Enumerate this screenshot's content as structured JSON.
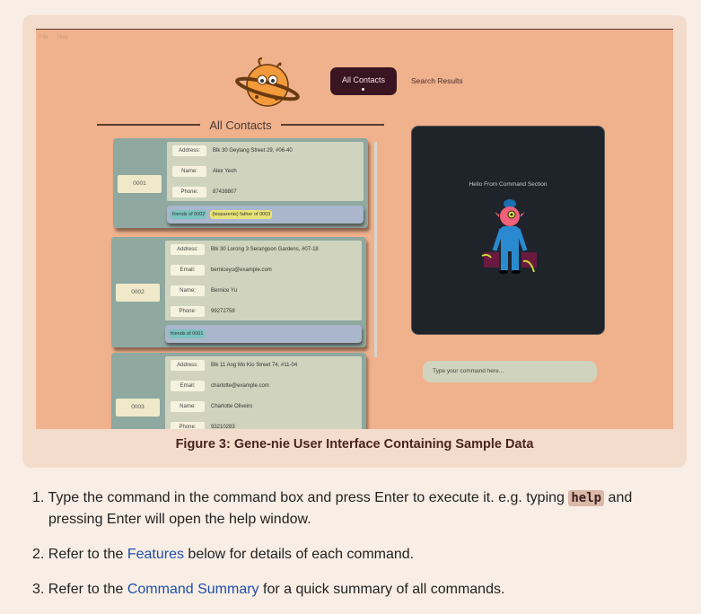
{
  "app": {
    "menu": [
      "File",
      "Help"
    ],
    "nav": {
      "active": "All Contacts",
      "other": "Search Results"
    },
    "section_title": "All Contacts",
    "contacts": [
      {
        "id": "0001",
        "fields": [
          [
            "Address:",
            "Blk 30 Geylang Street 29, #06-40"
          ],
          [
            "Name:",
            "Alex Yeoh"
          ],
          [
            "Phone:",
            "87438807"
          ]
        ],
        "tags": [
          {
            "text": "friends of 0002",
            "color": "cyan"
          },
          {
            "text": "(bioparents) father of 0003",
            "color": "yellow"
          }
        ]
      },
      {
        "id": "0002",
        "fields": [
          [
            "Address:",
            "Blk 30 Lorong 3 Serangoon Gardens, #07-18"
          ],
          [
            "Email:",
            "berniceyu@example.com"
          ],
          [
            "Name:",
            "Bernice Yu"
          ],
          [
            "Phone:",
            "99272758"
          ]
        ],
        "tags": [
          {
            "text": "friends of 0001",
            "color": "cyan"
          }
        ]
      },
      {
        "id": "0003",
        "fields": [
          [
            "Address:",
            "Blk 11 Ang Mo Kio Street 74, #11-04"
          ],
          [
            "Email:",
            "charlotte@example.com"
          ],
          [
            "Name:",
            "Charlotte Oliveiro"
          ],
          [
            "Phone:",
            "93210283"
          ]
        ],
        "tags": []
      }
    ],
    "command_section": {
      "message": "Hello From Command Section"
    },
    "command_input": {
      "placeholder": "Type your command here..."
    }
  },
  "caption": "Figure 3: Gene-nie User Interface Containing Sample Data",
  "steps": {
    "s1": {
      "num": "1. ",
      "a": "Type the command in the command box and press Enter to execute it. e.g. typing ",
      "code": "help",
      "b": " and pressing Enter will open the help window."
    },
    "s2": {
      "num": "2. ",
      "a": "Refer to the ",
      "link": "Features",
      "b": " below for details of each command."
    },
    "s3": {
      "num": "3. ",
      "a": "Refer to the ",
      "link": "Command Summary",
      "b": " for a quick summary of all commands."
    }
  },
  "colors": {
    "app_bg": "#f0b28c",
    "nav_active": "#3a1420",
    "card": "#8fa8a0",
    "command_panel": "#1f242b",
    "link": "#1f4fa8"
  }
}
